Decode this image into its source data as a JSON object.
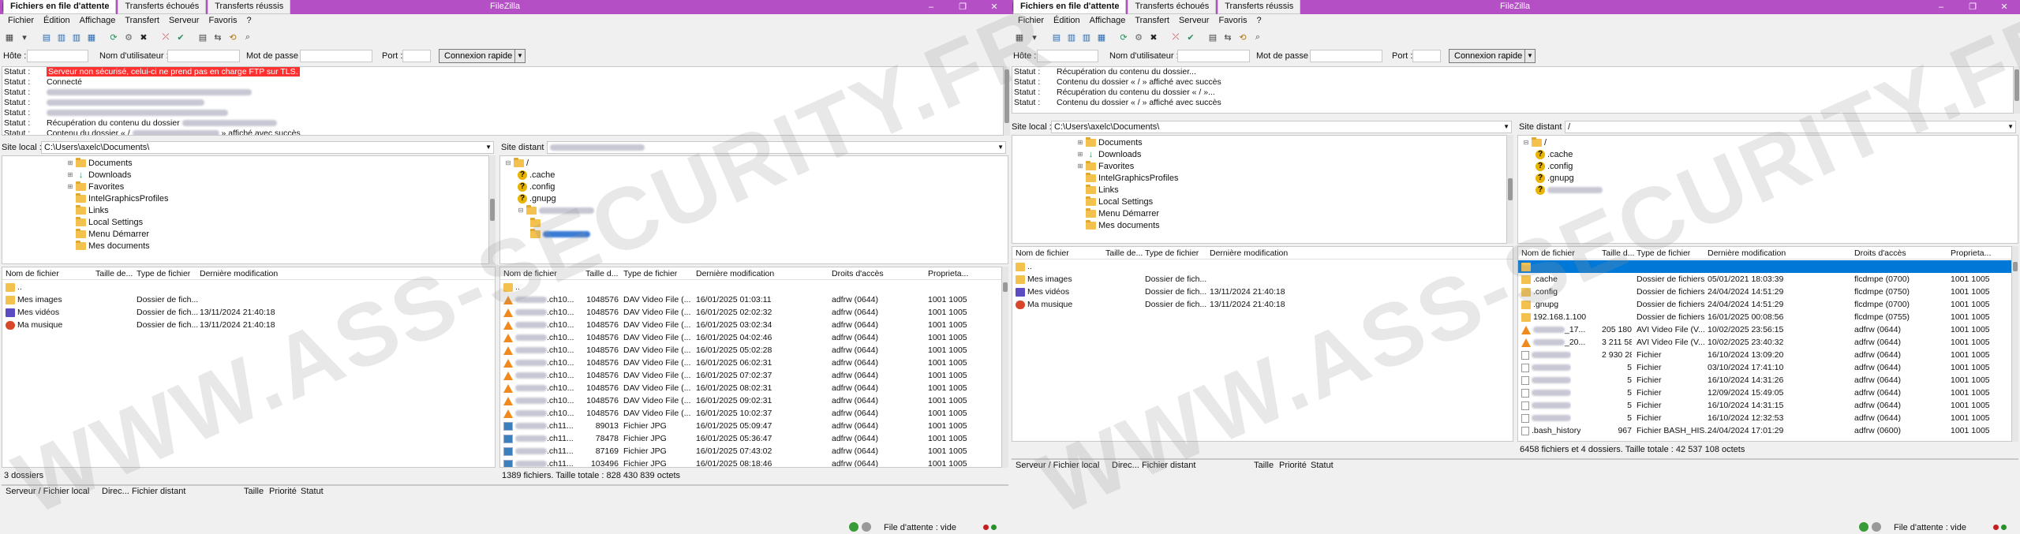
{
  "colors": {
    "titlebar": "#b44fc6",
    "error_bg": "#ff3030",
    "selection": "#0078d7"
  },
  "watermark": "WWW.ASS-SECURITY.FR",
  "app_title": "FileZilla",
  "menu": [
    "Fichier",
    "Édition",
    "Affichage",
    "Transfert",
    "Serveur",
    "Favoris",
    "?"
  ],
  "quickconnect": {
    "host_label": "Hôte :",
    "user_label": "Nom d'utilisateur :",
    "pass_label": "Mot de passe :",
    "port_label": "Port :",
    "button": "Connexion rapide"
  },
  "left": {
    "log": [
      {
        "label": "Statut :",
        "text": "Serveur non sécurisé, celui-ci ne prend pas en charge FTP sur TLS.",
        "error": true
      },
      {
        "label": "Statut :",
        "text": "Connecté"
      },
      {
        "label": "Statut :",
        "text": "",
        "blur": 260
      },
      {
        "label": "Statut :",
        "text": "",
        "blur": 200
      },
      {
        "label": "Statut :",
        "text": "",
        "blur": 230
      },
      {
        "label": "Statut :",
        "text": "Récupération du contenu du dossier",
        "blur_after": 120
      },
      {
        "label": "Statut :",
        "text": "Contenu du dossier « /",
        "text2": "» affiché avec succès",
        "blur_mid": 110
      }
    ],
    "local_site_label": "Site local :",
    "local_path": "C:\\Users\\axelc\\Documents\\",
    "remote_site_label": "Site distant :",
    "remote_path": "",
    "local_tree": [
      "Documents",
      "Downloads",
      "Favorites",
      "IntelGraphicsProfiles",
      "Links",
      "Local Settings",
      "Menu Démarrer",
      "Mes documents"
    ],
    "remote_tree": [
      "/",
      ".cache",
      ".config",
      ".gnupg"
    ],
    "local_headers": [
      "Nom de fichier",
      "Taille de...",
      "Type de fichier",
      "Dernière modification"
    ],
    "local_files": [
      {
        "name": "..",
        "size": "",
        "type": "",
        "date": "",
        "icon": "f"
      },
      {
        "name": "Mes images",
        "size": "",
        "type": "Dossier de fich...",
        "date": "",
        "icon": "f"
      },
      {
        "name": "Mes vidéos",
        "size": "",
        "type": "Dossier de fich...",
        "date": "13/11/2024 21:40:18",
        "icon": "vid"
      },
      {
        "name": "Ma musique",
        "size": "",
        "type": "Dossier de fich...",
        "date": "13/11/2024 21:40:18",
        "icon": "mus"
      }
    ],
    "local_status": "3 dossiers",
    "remote_headers": [
      "Nom de fichier",
      "Taille d...",
      "Type de fichier",
      "Dernière modification",
      "Droits d'accès",
      "Proprieta..."
    ],
    "remote_files": [
      {
        "name": "..",
        "size": "",
        "type": "",
        "date": "",
        "perm": "",
        "owner": "",
        "icon": "f"
      },
      {
        "name": ".ch10...",
        "size": "1048576",
        "type": "DAV Video File (...",
        "date": "16/01/2025 01:03:11",
        "perm": "adfrw (0644)",
        "owner": "1001 1005",
        "icon": "cone"
      },
      {
        "name": ".ch10...",
        "size": "1048576",
        "type": "DAV Video File (...",
        "date": "16/01/2025 02:02:32",
        "perm": "adfrw (0644)",
        "owner": "1001 1005",
        "icon": "cone"
      },
      {
        "name": ".ch10...",
        "size": "1048576",
        "type": "DAV Video File (...",
        "date": "16/01/2025 03:02:34",
        "perm": "adfrw (0644)",
        "owner": "1001 1005",
        "icon": "cone"
      },
      {
        "name": ".ch10...",
        "size": "1048576",
        "type": "DAV Video File (...",
        "date": "16/01/2025 04:02:46",
        "perm": "adfrw (0644)",
        "owner": "1001 1005",
        "icon": "cone"
      },
      {
        "name": ".ch10...",
        "size": "1048576",
        "type": "DAV Video File (...",
        "date": "16/01/2025 05:02:28",
        "perm": "adfrw (0644)",
        "owner": "1001 1005",
        "icon": "cone"
      },
      {
        "name": ".ch10...",
        "size": "1048576",
        "type": "DAV Video File (...",
        "date": "16/01/2025 06:02:31",
        "perm": "adfrw (0644)",
        "owner": "1001 1005",
        "icon": "cone"
      },
      {
        "name": ".ch10...",
        "size": "1048576",
        "type": "DAV Video File (...",
        "date": "16/01/2025 07:02:37",
        "perm": "adfrw (0644)",
        "owner": "1001 1005",
        "icon": "cone"
      },
      {
        "name": ".ch10...",
        "size": "1048576",
        "type": "DAV Video File (...",
        "date": "16/01/2025 08:02:31",
        "perm": "adfrw (0644)",
        "owner": "1001 1005",
        "icon": "cone"
      },
      {
        "name": ".ch10...",
        "size": "1048576",
        "type": "DAV Video File (...",
        "date": "16/01/2025 09:02:31",
        "perm": "adfrw (0644)",
        "owner": "1001 1005",
        "icon": "cone"
      },
      {
        "name": ".ch10...",
        "size": "1048576",
        "type": "DAV Video File (...",
        "date": "16/01/2025 10:02:37",
        "perm": "adfrw (0644)",
        "owner": "1001 1005",
        "icon": "cone"
      },
      {
        "name": ".ch11...",
        "size": "89013",
        "type": "Fichier JPG",
        "date": "16/01/2025 05:09:47",
        "perm": "adfrw (0644)",
        "owner": "1001 1005",
        "icon": "jpg"
      },
      {
        "name": ".ch11...",
        "size": "78478",
        "type": "Fichier JPG",
        "date": "16/01/2025 05:36:47",
        "perm": "adfrw (0644)",
        "owner": "1001 1005",
        "icon": "jpg"
      },
      {
        "name": ".ch11...",
        "size": "87169",
        "type": "Fichier JPG",
        "date": "16/01/2025 07:43:02",
        "perm": "adfrw (0644)",
        "owner": "1001 1005",
        "icon": "jpg"
      },
      {
        "name": ".ch11...",
        "size": "103496",
        "type": "Fichier JPG",
        "date": "16/01/2025 08:18:46",
        "perm": "adfrw (0644)",
        "owner": "1001 1005",
        "icon": "jpg"
      }
    ],
    "remote_status": "1389 fichiers. Taille totale : 828 430 839 octets",
    "queue_headers": [
      "Serveur / Fichier local",
      "Direc...",
      "Fichier distant",
      "Taille",
      "Priorité",
      "Statut"
    ],
    "queue_tabs": [
      "Fichiers en file d'attente",
      "Transferts échoués",
      "Transferts réussis"
    ],
    "queue_status": "File d'attente : vide"
  },
  "right": {
    "log": [
      {
        "label": "Statut :",
        "text": "Récupération du contenu du dossier..."
      },
      {
        "label": "Statut :",
        "text": "Contenu du dossier « / » affiché avec succès"
      },
      {
        "label": "Statut :",
        "text": "Récupération du contenu du dossier « / »..."
      },
      {
        "label": "Statut :",
        "text": "Contenu du dossier « / » affiché avec succès"
      }
    ],
    "local_site_label": "Site local :",
    "local_path": "C:\\Users\\axelc\\Documents\\",
    "remote_site_label": "Site distant :",
    "remote_path": "/",
    "local_tree": [
      "Documents",
      "Downloads",
      "Favorites",
      "IntelGraphicsProfiles",
      "Links",
      "Local Settings",
      "Menu Démarrer",
      "Mes documents"
    ],
    "remote_tree": [
      "/",
      ".cache",
      ".config",
      ".gnupg"
    ],
    "local_headers": [
      "Nom de fichier",
      "Taille de...",
      "Type de fichier",
      "Dernière modification"
    ],
    "local_files": [
      {
        "name": "..",
        "size": "",
        "type": "",
        "date": "",
        "icon": "f"
      },
      {
        "name": "Mes images",
        "size": "",
        "type": "Dossier de fich...",
        "date": "",
        "icon": "f"
      },
      {
        "name": "Mes vidéos",
        "size": "",
        "type": "Dossier de fich...",
        "date": "13/11/2024 21:40:18",
        "icon": "vid"
      },
      {
        "name": "Ma musique",
        "size": "",
        "type": "Dossier de fich...",
        "date": "13/11/2024 21:40:18",
        "icon": "mus"
      }
    ],
    "local_status": "",
    "remote_headers": [
      "Nom de fichier",
      "Taille d...",
      "Type de fichier",
      "Dernière modification",
      "Droits d'accès",
      "Proprieta..."
    ],
    "remote_files": [
      {
        "name": "",
        "size": "",
        "type": "",
        "date": "",
        "perm": "",
        "owner": "",
        "icon": "f",
        "selected": true
      },
      {
        "name": ".cache",
        "size": "",
        "type": "Dossier de fichiers",
        "date": "05/01/2021 18:03:39",
        "perm": "flcdmpe (0700)",
        "owner": "1001 1005",
        "icon": "f"
      },
      {
        "name": ".config",
        "size": "",
        "type": "Dossier de fichiers",
        "date": "24/04/2024 14:51:29",
        "perm": "flcdmpe (0750)",
        "owner": "1001 1005",
        "icon": "f"
      },
      {
        "name": ".gnupg",
        "size": "",
        "type": "Dossier de fichiers",
        "date": "24/04/2024 14:51:29",
        "perm": "flcdmpe (0700)",
        "owner": "1001 1005",
        "icon": "f"
      },
      {
        "name": "192.168.1.100",
        "size": "",
        "type": "Dossier de fichiers",
        "date": "16/01/2025 00:08:56",
        "perm": "flcdmpe (0755)",
        "owner": "1001 1005",
        "icon": "f"
      },
      {
        "name": "_17...",
        "size": "205 180",
        "type": "AVI Video File (V...",
        "date": "10/02/2025 23:56:15",
        "perm": "adfrw (0644)",
        "owner": "1001 1005",
        "icon": "cone"
      },
      {
        "name": "_20...",
        "size": "3 211 584",
        "type": "AVI Video File (V...",
        "date": "10/02/2025 23:40:32",
        "perm": "adfrw (0644)",
        "owner": "1001 1005",
        "icon": "cone"
      },
      {
        "name": "",
        "size": "2 930 287",
        "type": "Fichier",
        "date": "16/10/2024 13:09:20",
        "perm": "adfrw (0644)",
        "owner": "1001 1005",
        "icon": "file"
      },
      {
        "name": "",
        "size": "5",
        "type": "Fichier",
        "date": "03/10/2024 17:41:10",
        "perm": "adfrw (0644)",
        "owner": "1001 1005",
        "icon": "file"
      },
      {
        "name": "",
        "size": "5",
        "type": "Fichier",
        "date": "16/10/2024 14:31:26",
        "perm": "adfrw (0644)",
        "owner": "1001 1005",
        "icon": "file"
      },
      {
        "name": "",
        "size": "5",
        "type": "Fichier",
        "date": "12/09/2024 15:49:05",
        "perm": "adfrw (0644)",
        "owner": "1001 1005",
        "icon": "file"
      },
      {
        "name": "",
        "size": "5",
        "type": "Fichier",
        "date": "16/10/2024 14:31:15",
        "perm": "adfrw (0644)",
        "owner": "1001 1005",
        "icon": "file"
      },
      {
        "name": "",
        "size": "5",
        "type": "Fichier",
        "date": "16/10/2024 12:32:53",
        "perm": "adfrw (0644)",
        "owner": "1001 1005",
        "icon": "file"
      },
      {
        "name": ".bash_history",
        "size": "967",
        "type": "Fichier BASH_HIS...",
        "date": "24/04/2024 17:01:29",
        "perm": "adfrw (0600)",
        "owner": "1001 1005",
        "icon": "file"
      }
    ],
    "remote_status": "6458 fichiers et 4 dossiers. Taille totale : 42 537 108 octets",
    "queue_headers": [
      "Serveur / Fichier local",
      "Direc...",
      "Fichier distant",
      "Taille",
      "Priorité",
      "Statut"
    ],
    "queue_tabs": [
      "Fichiers en file d'attente",
      "Transferts échoués",
      "Transferts réussis"
    ],
    "queue_status": "File d'attente : vide"
  }
}
